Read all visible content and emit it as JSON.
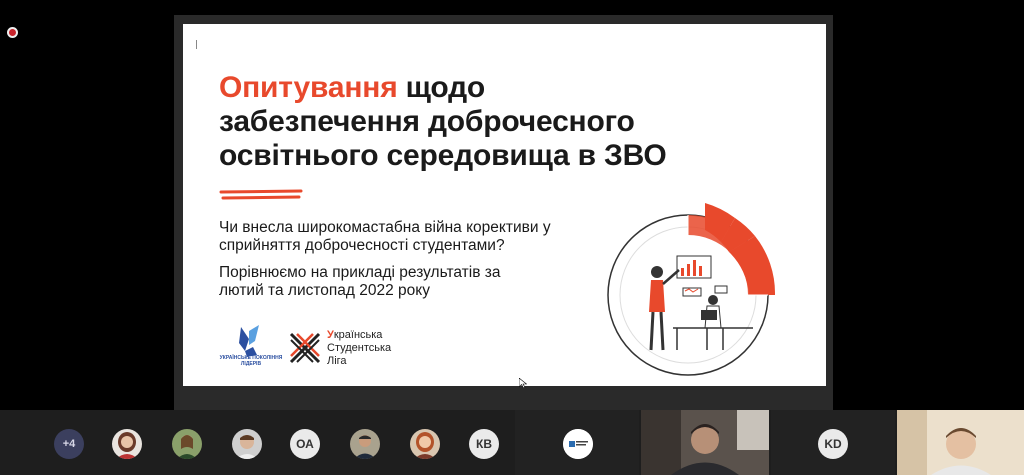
{
  "slide": {
    "title_accent": "Опитування",
    "title_rest_line1": "щодо",
    "title_line2": "забезпечення доброчесного",
    "title_line3": "освітнього середовища в ЗВО",
    "question": "Чи внесла широкомастабна війна корективи у сприйняття доброчесності студентами?",
    "compare": "Порівнюємо на прикладі результатів за лютий та листопад 2022 року",
    "logo_left_text": "УКРАЇНСЬКЕ ПОКОЛІННЯ ЛІДЕРІВ",
    "logo_right_line1_accent": "У",
    "logo_right_line1_rest": "країнська",
    "logo_right_line2": "Студентська",
    "logo_right_line3": "Ліга"
  },
  "participants": {
    "more_count": "+4",
    "initials_oa": "ОА",
    "initials_kv": "КВ",
    "initials_kd": "KD"
  },
  "colors": {
    "accent": "#e8492c",
    "background": "#000000",
    "bar": "#1e1e1e"
  }
}
